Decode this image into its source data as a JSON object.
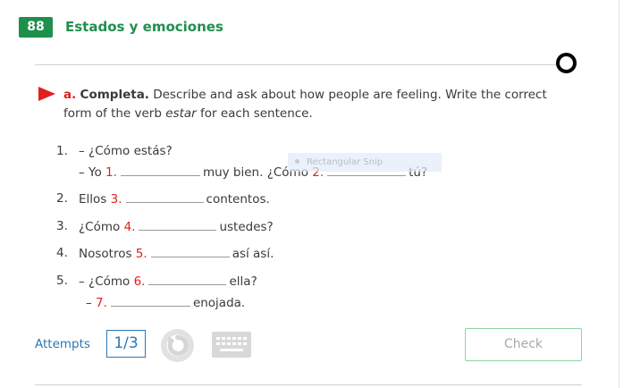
{
  "header": {
    "badge": "88",
    "title": "Estados y emociones"
  },
  "instructions": {
    "letter": "a.",
    "bold": "Completa.",
    "text1": " Describe and ask about how people are feeling. Write the correct form of the verb ",
    "verb": "estar",
    "text2": " for each sentence."
  },
  "items": [
    {
      "num": "1.",
      "line1": "– ¿Cómo estás?",
      "line2a": "– Yo ",
      "n1": "1.",
      "line2b": "muy bien. ¿Cómo ",
      "n2": "2.",
      "line2c": "tú?"
    },
    {
      "num": "2.",
      "pre": "Ellos ",
      "n": "3.",
      "post": "contentos."
    },
    {
      "num": "3.",
      "pre": "¿Cómo ",
      "n": "4.",
      "post": "ustedes?"
    },
    {
      "num": "4.",
      "pre": "Nosotros ",
      "n": "5.",
      "post": "así así."
    },
    {
      "num": "5.",
      "pre": "– ¿Cómo ",
      "n": "6.",
      "post": "ella?",
      "line2pre": "– ",
      "n2": "7.",
      "line2post": "enojada."
    }
  ],
  "overlay": {
    "snip_label": "Rectangular Snip"
  },
  "footer": {
    "attempts_label": "Attempts",
    "attempts_value": "1/3",
    "check_label": "Check",
    "retry_icon": "retry-icon",
    "keyboard_icon": "keyboard-icon"
  },
  "colors": {
    "green": "#1f8f4d",
    "red": "#e0201c",
    "blue": "#2878b8"
  }
}
